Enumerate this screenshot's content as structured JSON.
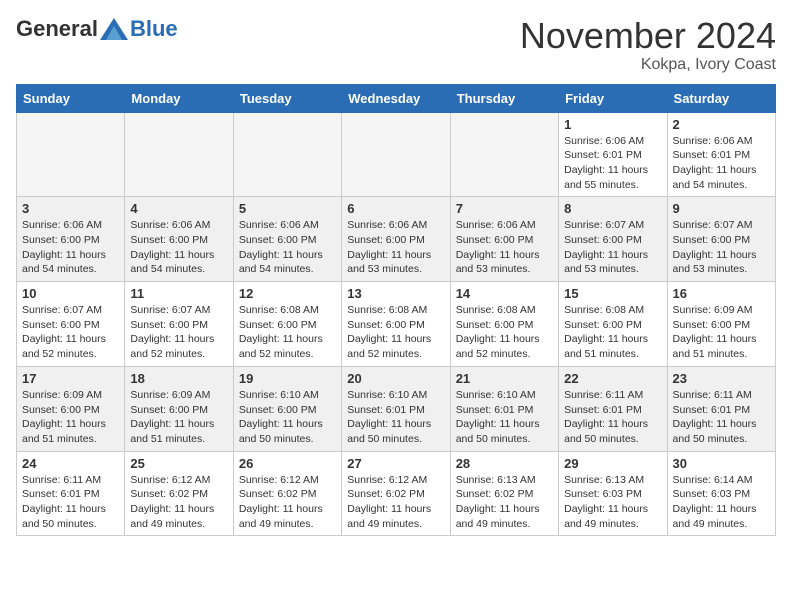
{
  "header": {
    "logo_general": "General",
    "logo_blue": "Blue",
    "month_title": "November 2024",
    "location": "Kokpa, Ivory Coast"
  },
  "days_of_week": [
    "Sunday",
    "Monday",
    "Tuesday",
    "Wednesday",
    "Thursday",
    "Friday",
    "Saturday"
  ],
  "weeks": [
    {
      "alt": false,
      "days": [
        {
          "num": "",
          "info": ""
        },
        {
          "num": "",
          "info": ""
        },
        {
          "num": "",
          "info": ""
        },
        {
          "num": "",
          "info": ""
        },
        {
          "num": "",
          "info": ""
        },
        {
          "num": "1",
          "info": "Sunrise: 6:06 AM\nSunset: 6:01 PM\nDaylight: 11 hours\nand 55 minutes."
        },
        {
          "num": "2",
          "info": "Sunrise: 6:06 AM\nSunset: 6:01 PM\nDaylight: 11 hours\nand 54 minutes."
        }
      ]
    },
    {
      "alt": true,
      "days": [
        {
          "num": "3",
          "info": "Sunrise: 6:06 AM\nSunset: 6:00 PM\nDaylight: 11 hours\nand 54 minutes."
        },
        {
          "num": "4",
          "info": "Sunrise: 6:06 AM\nSunset: 6:00 PM\nDaylight: 11 hours\nand 54 minutes."
        },
        {
          "num": "5",
          "info": "Sunrise: 6:06 AM\nSunset: 6:00 PM\nDaylight: 11 hours\nand 54 minutes."
        },
        {
          "num": "6",
          "info": "Sunrise: 6:06 AM\nSunset: 6:00 PM\nDaylight: 11 hours\nand 53 minutes."
        },
        {
          "num": "7",
          "info": "Sunrise: 6:06 AM\nSunset: 6:00 PM\nDaylight: 11 hours\nand 53 minutes."
        },
        {
          "num": "8",
          "info": "Sunrise: 6:07 AM\nSunset: 6:00 PM\nDaylight: 11 hours\nand 53 minutes."
        },
        {
          "num": "9",
          "info": "Sunrise: 6:07 AM\nSunset: 6:00 PM\nDaylight: 11 hours\nand 53 minutes."
        }
      ]
    },
    {
      "alt": false,
      "days": [
        {
          "num": "10",
          "info": "Sunrise: 6:07 AM\nSunset: 6:00 PM\nDaylight: 11 hours\nand 52 minutes."
        },
        {
          "num": "11",
          "info": "Sunrise: 6:07 AM\nSunset: 6:00 PM\nDaylight: 11 hours\nand 52 minutes."
        },
        {
          "num": "12",
          "info": "Sunrise: 6:08 AM\nSunset: 6:00 PM\nDaylight: 11 hours\nand 52 minutes."
        },
        {
          "num": "13",
          "info": "Sunrise: 6:08 AM\nSunset: 6:00 PM\nDaylight: 11 hours\nand 52 minutes."
        },
        {
          "num": "14",
          "info": "Sunrise: 6:08 AM\nSunset: 6:00 PM\nDaylight: 11 hours\nand 52 minutes."
        },
        {
          "num": "15",
          "info": "Sunrise: 6:08 AM\nSunset: 6:00 PM\nDaylight: 11 hours\nand 51 minutes."
        },
        {
          "num": "16",
          "info": "Sunrise: 6:09 AM\nSunset: 6:00 PM\nDaylight: 11 hours\nand 51 minutes."
        }
      ]
    },
    {
      "alt": true,
      "days": [
        {
          "num": "17",
          "info": "Sunrise: 6:09 AM\nSunset: 6:00 PM\nDaylight: 11 hours\nand 51 minutes."
        },
        {
          "num": "18",
          "info": "Sunrise: 6:09 AM\nSunset: 6:00 PM\nDaylight: 11 hours\nand 51 minutes."
        },
        {
          "num": "19",
          "info": "Sunrise: 6:10 AM\nSunset: 6:00 PM\nDaylight: 11 hours\nand 50 minutes."
        },
        {
          "num": "20",
          "info": "Sunrise: 6:10 AM\nSunset: 6:01 PM\nDaylight: 11 hours\nand 50 minutes."
        },
        {
          "num": "21",
          "info": "Sunrise: 6:10 AM\nSunset: 6:01 PM\nDaylight: 11 hours\nand 50 minutes."
        },
        {
          "num": "22",
          "info": "Sunrise: 6:11 AM\nSunset: 6:01 PM\nDaylight: 11 hours\nand 50 minutes."
        },
        {
          "num": "23",
          "info": "Sunrise: 6:11 AM\nSunset: 6:01 PM\nDaylight: 11 hours\nand 50 minutes."
        }
      ]
    },
    {
      "alt": false,
      "days": [
        {
          "num": "24",
          "info": "Sunrise: 6:11 AM\nSunset: 6:01 PM\nDaylight: 11 hours\nand 50 minutes."
        },
        {
          "num": "25",
          "info": "Sunrise: 6:12 AM\nSunset: 6:02 PM\nDaylight: 11 hours\nand 49 minutes."
        },
        {
          "num": "26",
          "info": "Sunrise: 6:12 AM\nSunset: 6:02 PM\nDaylight: 11 hours\nand 49 minutes."
        },
        {
          "num": "27",
          "info": "Sunrise: 6:12 AM\nSunset: 6:02 PM\nDaylight: 11 hours\nand 49 minutes."
        },
        {
          "num": "28",
          "info": "Sunrise: 6:13 AM\nSunset: 6:02 PM\nDaylight: 11 hours\nand 49 minutes."
        },
        {
          "num": "29",
          "info": "Sunrise: 6:13 AM\nSunset: 6:03 PM\nDaylight: 11 hours\nand 49 minutes."
        },
        {
          "num": "30",
          "info": "Sunrise: 6:14 AM\nSunset: 6:03 PM\nDaylight: 11 hours\nand 49 minutes."
        }
      ]
    }
  ]
}
